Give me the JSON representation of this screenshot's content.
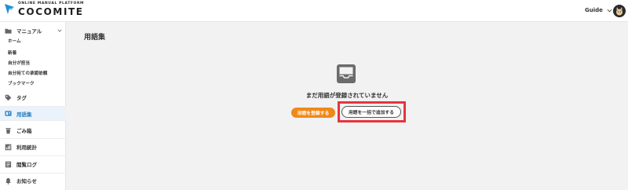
{
  "header": {
    "logo_tagline": "ONLINE MANUAL PLATFORM",
    "logo_name": "COCOMITE",
    "guide_label": "Guide",
    "logo_color": "#1f8ed1"
  },
  "sidebar": {
    "manual": {
      "label": "マニュアル",
      "icon": "folder-icon"
    },
    "sub_items": [
      "ホーム",
      "新着",
      "自分が担当",
      "自分宛ての承認依頼",
      "ブックマーク"
    ],
    "items": [
      {
        "label": "タグ",
        "icon": "tag-icon"
      },
      {
        "label": "用語集",
        "icon": "glossary-icon",
        "active": true
      },
      {
        "label": "ごみ箱",
        "icon": "trash-icon"
      },
      {
        "label": "利用統計",
        "icon": "stats-icon"
      },
      {
        "label": "閲覧ログ",
        "icon": "log-icon"
      },
      {
        "label": "お知らせ",
        "icon": "bell-icon"
      }
    ],
    "active_color": "#2a7fc1"
  },
  "main": {
    "page_title": "用語集",
    "empty_icon": "inbox-icon",
    "empty_message": "まだ用語が登録されていません",
    "register_button": "用語を登録する",
    "bulk_add_button": "用語を一括で追加する",
    "register_button_color": "#f0891a",
    "highlight_color": "#e8333f"
  }
}
